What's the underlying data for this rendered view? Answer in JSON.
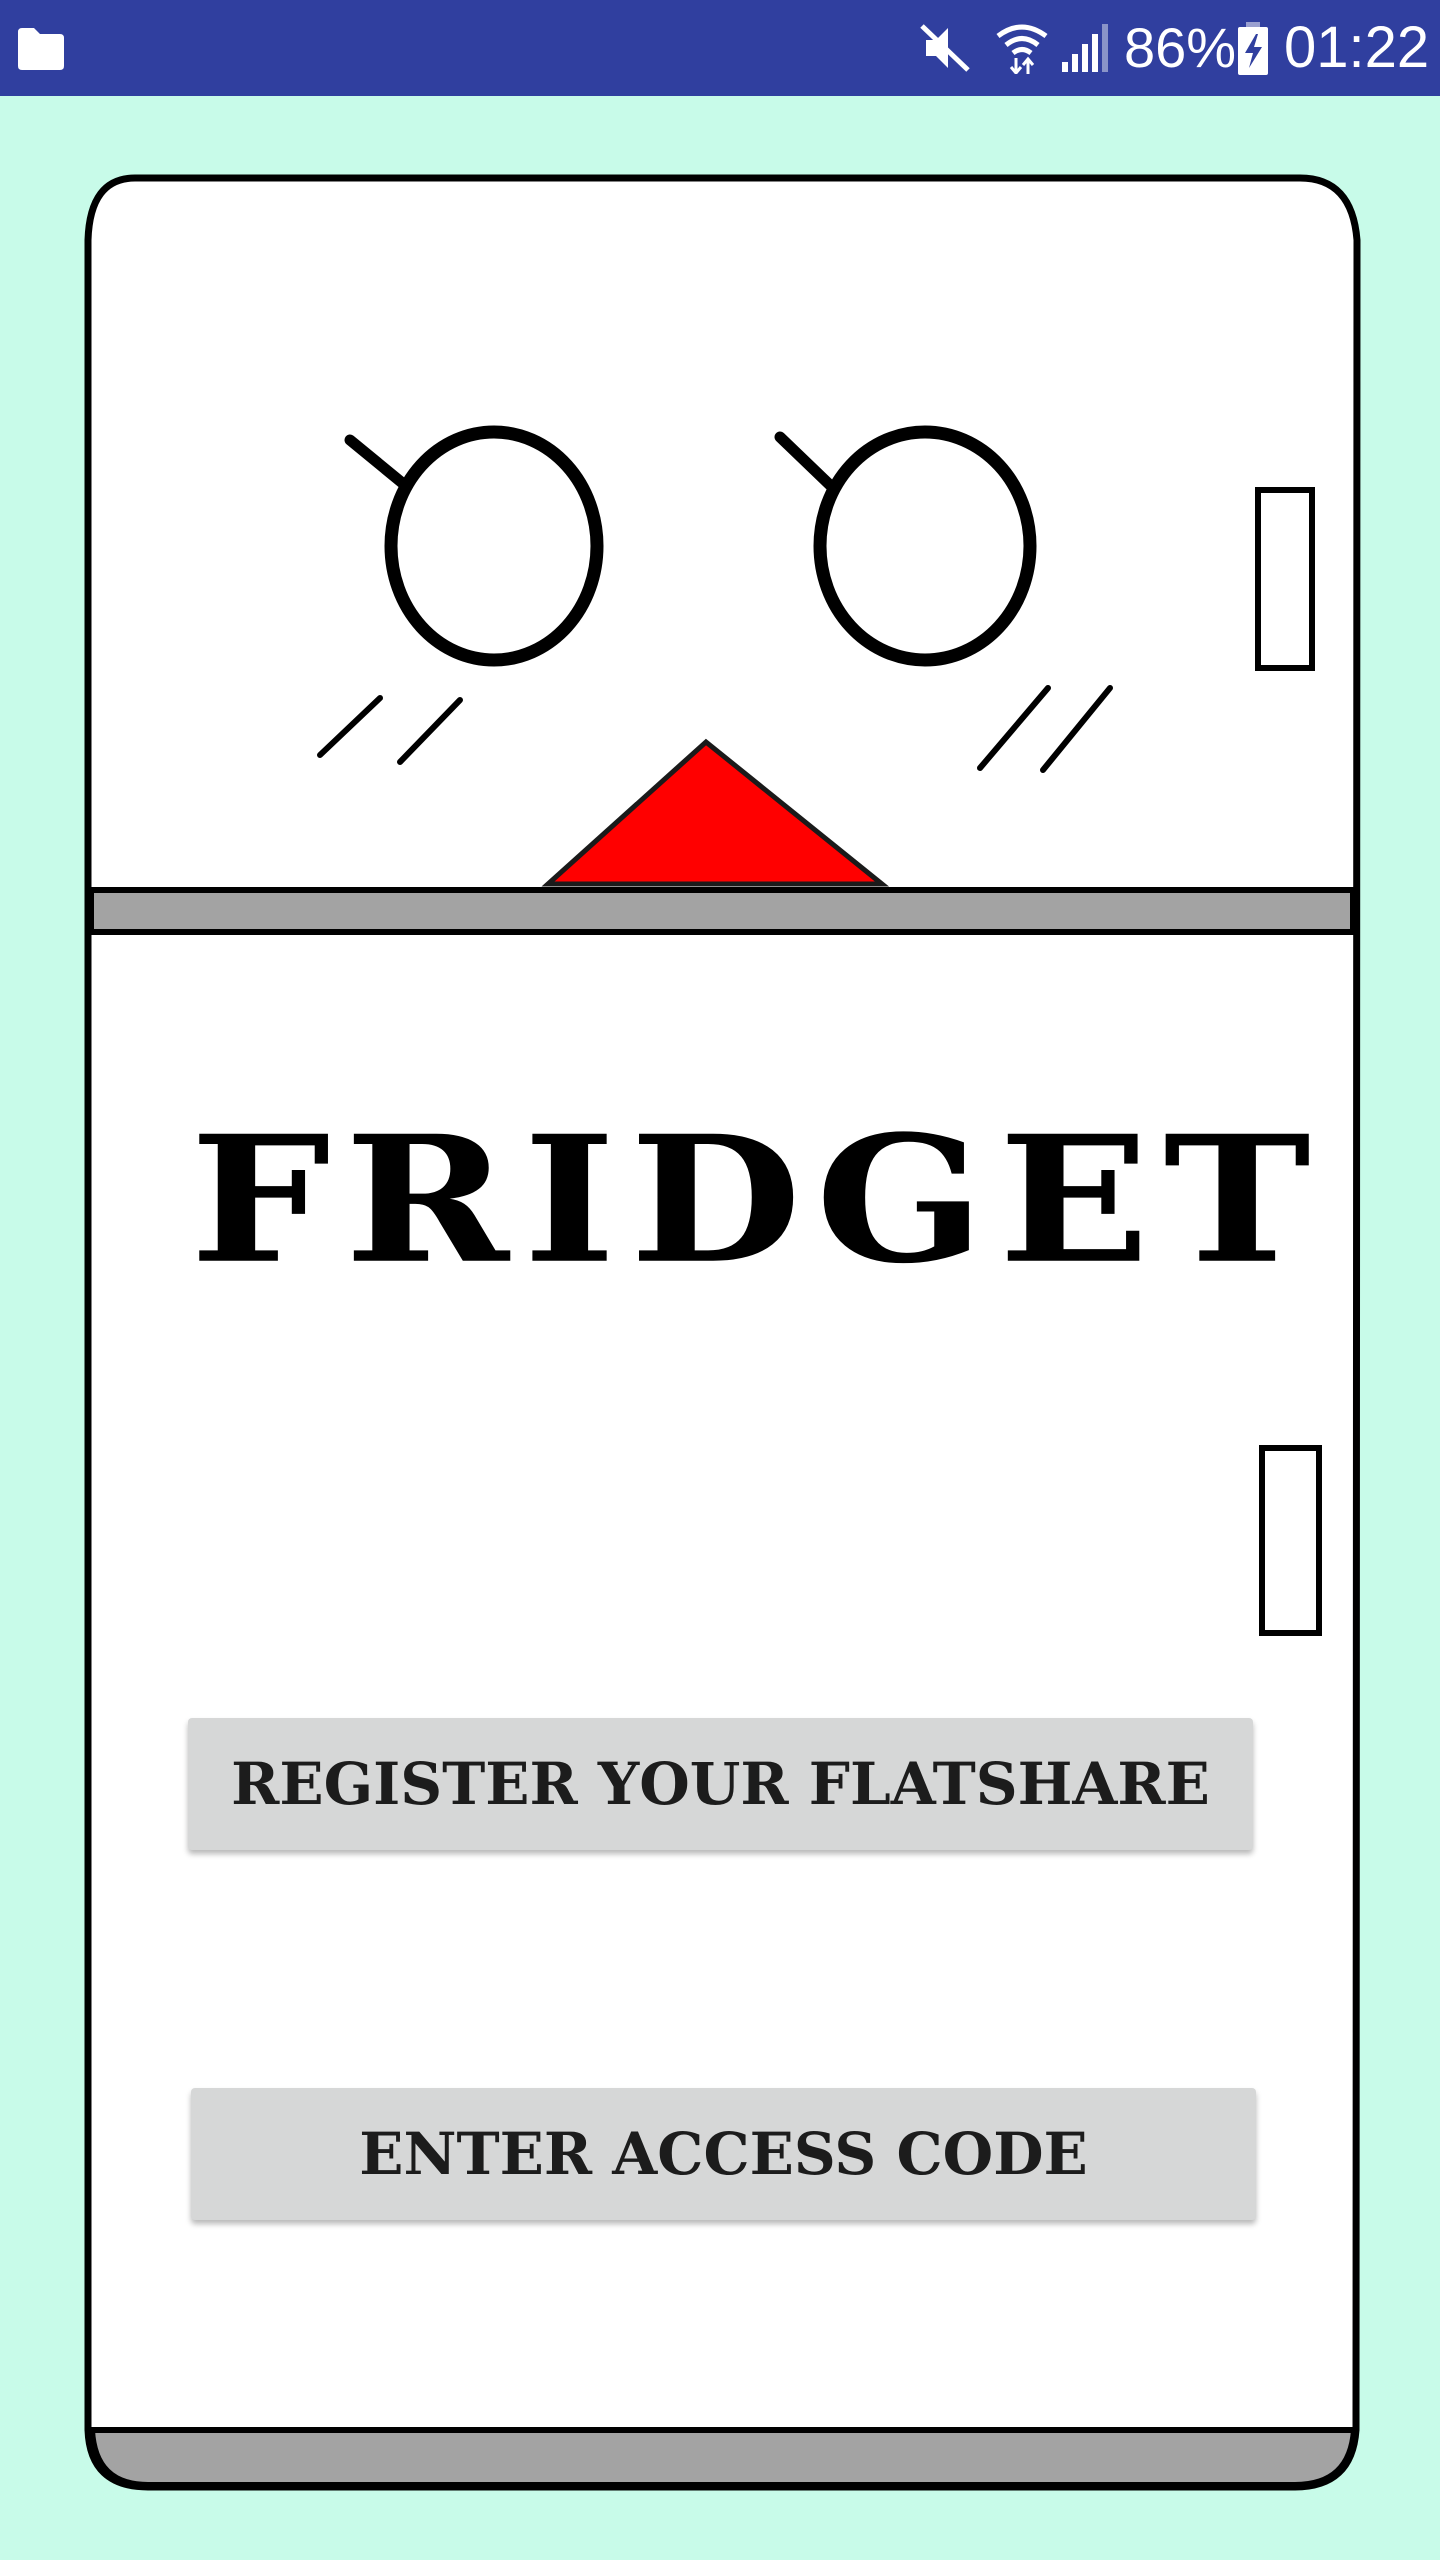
{
  "status_bar": {
    "battery_percent": "86%",
    "time": "01:22",
    "icons": [
      "folder-icon",
      "mute-icon",
      "wifi-icon",
      "signal-icon",
      "battery-charging-icon"
    ]
  },
  "app": {
    "logo_text": "FRIDGET",
    "register_button": "REGISTER YOUR FLATSHARE",
    "access_code_button": "ENTER ACCESS CODE"
  },
  "colors": {
    "status_bar": "#303f9f",
    "background": "#c8fbe9",
    "fridge_body": "#ffffff",
    "fridge_divider": "#a3a3a3",
    "beak": "#ff0000",
    "button": "#d6d7d7"
  }
}
